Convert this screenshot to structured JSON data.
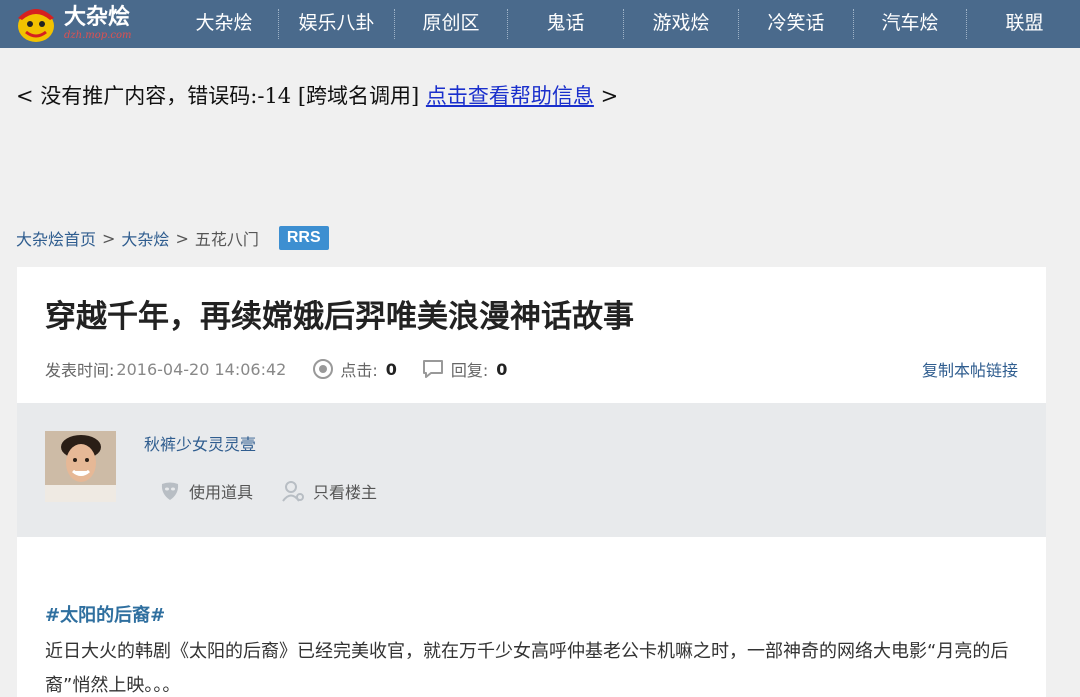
{
  "nav": {
    "logo_title": "大杂烩",
    "logo_url": "dzh.mop.com",
    "items": [
      "大杂烩",
      "娱乐八卦",
      "原创区",
      "鬼话",
      "游戏烩",
      "冷笑话",
      "汽车烩",
      "联盟"
    ]
  },
  "ad": {
    "prefix": "< 没有推广内容，错误码:-14 [跨域名调用] ",
    "link": "点击查看帮助信息",
    "suffix": " >"
  },
  "breadcrumb": {
    "home": "大杂烩首页",
    "section": "大杂烩",
    "current": "五花八门",
    "sep": ">",
    "badge": "RRS"
  },
  "article": {
    "title": "穿越千年，再续嫦娥后羿唯美浪漫神话故事",
    "time_label": "发表时间:",
    "time_value": "2016-04-20 14:06:42",
    "clicks_label": "点击:",
    "clicks_value": "0",
    "replies_label": "回复:",
    "replies_value": "0",
    "copy_link": "复制本帖链接"
  },
  "author": {
    "name": "秋裤少女灵灵壹",
    "use_props": "使用道具",
    "only_op": "只看楼主"
  },
  "body": {
    "hashtag": "#太阳的后裔#",
    "paragraph": "近日大火的韩剧《太阳的后裔》已经完美收官，就在万千少女高呼仲基老公卡机嘛之时，一部神奇的网络大电影“月亮的后裔”悄然上映。。。"
  },
  "colors": {
    "nav_bg": "#4a6a8c",
    "link": "#2f5d8f",
    "badge": "#3d8fd1"
  }
}
